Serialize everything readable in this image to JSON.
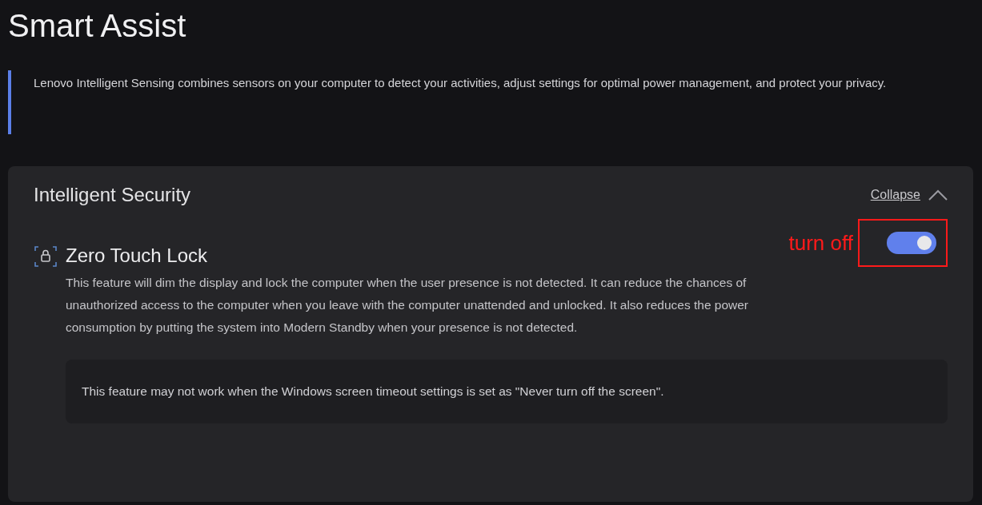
{
  "page_title": "Smart Assist",
  "intro": "Lenovo Intelligent Sensing combines sensors on your computer to detect your activities, adjust settings for optimal power management, and protect your privacy.",
  "section": {
    "title": "Intelligent Security",
    "collapse_link": "Collapse",
    "expanded": true,
    "features": [
      {
        "title": "Zero Touch Lock",
        "on": true,
        "description": "This feature will dim the display and lock the computer when the user presence is not detected. It can reduce the chances of unauthorized access to the computer when you leave with the computer unattended and unlocked. It also reduces the power consumption by putting the system into Modern Standby when your presence is not detected.",
        "note": "This feature may not work when the Windows screen timeout settings is set as \"Never turn off the screen\".",
        "annotation": "turn off"
      }
    ]
  }
}
